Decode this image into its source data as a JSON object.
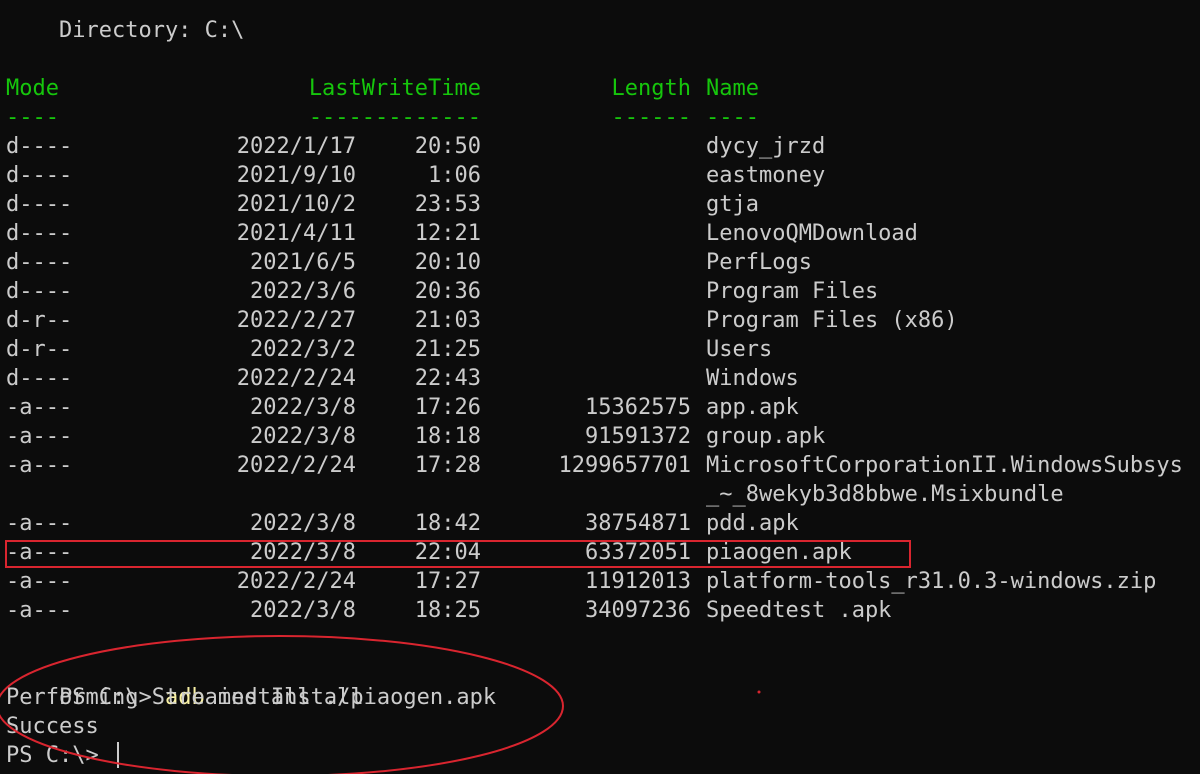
{
  "directory_line": "    Directory: C:\\",
  "headers": {
    "mode": "Mode",
    "lastwritetime": "LastWriteTime",
    "length": "Length",
    "name": "Name",
    "mode_underline": "----",
    "lastwritetime_underline": "-------------",
    "length_underline": "------",
    "name_underline": "----"
  },
  "entries": [
    {
      "mode": "d----",
      "date": "2022/1/17",
      "time": "20:50",
      "length": "",
      "name": "dycy_jrzd"
    },
    {
      "mode": "d----",
      "date": "2021/9/10",
      "time": "1:06",
      "length": "",
      "name": "eastmoney"
    },
    {
      "mode": "d----",
      "date": "2021/10/2",
      "time": "23:53",
      "length": "",
      "name": "gtja"
    },
    {
      "mode": "d----",
      "date": "2021/4/11",
      "time": "12:21",
      "length": "",
      "name": "LenovoQMDownload"
    },
    {
      "mode": "d----",
      "date": "2021/6/5",
      "time": "20:10",
      "length": "",
      "name": "PerfLogs"
    },
    {
      "mode": "d----",
      "date": "2022/3/6",
      "time": "20:36",
      "length": "",
      "name": "Program Files"
    },
    {
      "mode": "d-r--",
      "date": "2022/2/27",
      "time": "21:03",
      "length": "",
      "name": "Program Files (x86)"
    },
    {
      "mode": "d-r--",
      "date": "2022/3/2",
      "time": "21:25",
      "length": "",
      "name": "Users"
    },
    {
      "mode": "d----",
      "date": "2022/2/24",
      "time": "22:43",
      "length": "",
      "name": "Windows"
    },
    {
      "mode": "-a---",
      "date": "2022/3/8",
      "time": "17:26",
      "length": "15362575",
      "name": "app.apk"
    },
    {
      "mode": "-a---",
      "date": "2022/3/8",
      "time": "18:18",
      "length": "91591372",
      "name": "group.apk"
    },
    {
      "mode": "-a---",
      "date": "2022/2/24",
      "time": "17:28",
      "length": "1299657701",
      "name": "MicrosoftCorporationII.WindowsSubsys"
    },
    {
      "mode": "",
      "date": "",
      "time": "",
      "length": "",
      "name": "_~_8wekyb3d8bbwe.Msixbundle"
    },
    {
      "mode": "-a---",
      "date": "2022/3/8",
      "time": "18:42",
      "length": "38754871",
      "name": "pdd.apk"
    },
    {
      "mode": "-a---",
      "date": "2022/3/8",
      "time": "22:04",
      "length": "63372051",
      "name": "piaogen.apk"
    },
    {
      "mode": "-a---",
      "date": "2022/2/24",
      "time": "17:27",
      "length": "11912013",
      "name": "platform-tools_r31.0.3-windows.zip"
    },
    {
      "mode": "-a---",
      "date": "2022/3/8",
      "time": "18:25",
      "length": "34097236",
      "name": "Speedtest .apk"
    }
  ],
  "session": {
    "prompt1": "PS C:\\> ",
    "command_name": "adb",
    "command_args": " install ./piaogen.apk",
    "output1": "Performing Streamed Install",
    "output2": "Success",
    "prompt2": "PS C:\\> "
  },
  "colors": {
    "background": "#0c0c0c",
    "foreground": "#cccccc",
    "header_green": "#16c60c",
    "command_yellow": "#f9f1a5",
    "annotation_red": "#d9252f"
  }
}
